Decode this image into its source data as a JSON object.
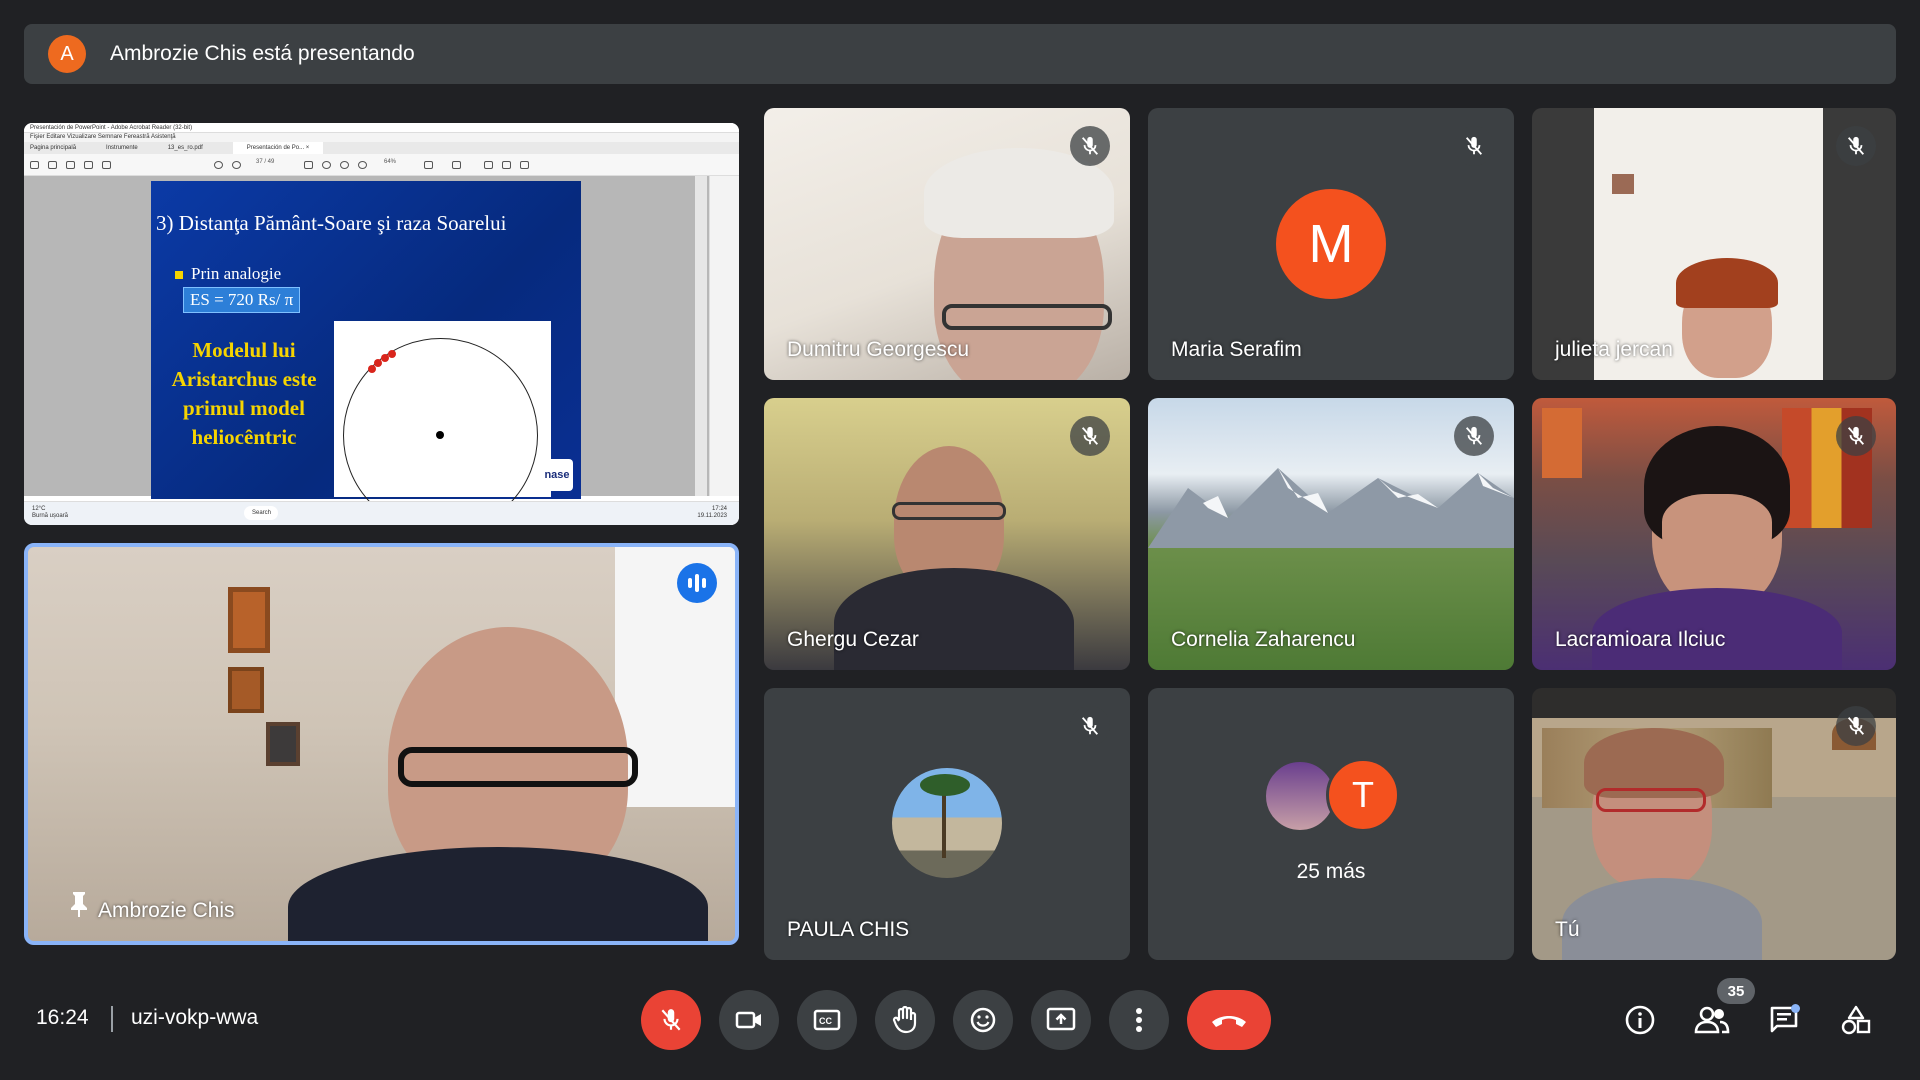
{
  "banner": {
    "avatar_letter": "A",
    "text": "Ambrozie Chis está presentando"
  },
  "shared_screen": {
    "window_title": "Presentación de PowerPoint - Adobe Acrobat Reader (32-bit)",
    "menu": "Fişier   Editare   Vizualizare   Semnare   Fereastră   Asistenţă",
    "tabs": [
      "Pagina principală",
      "Instrumente",
      "13_es_ro.pdf",
      "Presentación de Po... ×"
    ],
    "page_indicator": "37 / 49",
    "zoom": "64%",
    "slide": {
      "title": "3) Distanţa Pământ-Soare şi raza Soarelui",
      "bullet": "Prin analogie",
      "formula": "ES = 720 Rs/ π",
      "model_text": "Modelul lui Aristarchus este primul model heliocêntric",
      "logo": "nase"
    },
    "taskbar": {
      "weather_temp": "12°C",
      "weather_desc": "Burnă ușoară",
      "search": "Search",
      "time": "17:24",
      "date": "19.11.2023"
    }
  },
  "participants": [
    {
      "id": "dumitru",
      "name": "Dumitru Georgescu",
      "muted": true
    },
    {
      "id": "maria",
      "name": "Maria Serafim",
      "muted": true,
      "avatar_letter": "M",
      "avatar_color": "#f4511e"
    },
    {
      "id": "julieta",
      "name": "julieta jercan",
      "muted": true
    },
    {
      "id": "ghergu",
      "name": "Ghergu Cezar",
      "muted": true
    },
    {
      "id": "cornelia",
      "name": "Cornelia Zaharencu",
      "muted": true
    },
    {
      "id": "lacramioara",
      "name": "Lacramioara Ilciuc",
      "muted": true
    },
    {
      "id": "paula",
      "name": "PAULA CHIS",
      "muted": true
    },
    {
      "id": "more",
      "name": "25 más",
      "avatar_letter": "T",
      "avatar_color": "#f4511e"
    },
    {
      "id": "tu",
      "name": "Tú",
      "muted": true
    }
  ],
  "presenter_tile": {
    "name": "Ambrozie Chis",
    "pinned": true,
    "speaking": true
  },
  "bottom": {
    "time": "16:24",
    "meeting_code": "uzi-vokp-wwa",
    "participants_count": "35",
    "controls": [
      "mic-off",
      "camera",
      "captions",
      "raise-hand",
      "emoji",
      "present",
      "more-options",
      "end-call"
    ],
    "right_icons": [
      "info",
      "people",
      "chat",
      "activities"
    ]
  },
  "colors": {
    "bg": "#202124",
    "tile": "#3c4043",
    "red": "#ea4335",
    "accent": "#1a73e8",
    "orange": "#f4511e"
  }
}
